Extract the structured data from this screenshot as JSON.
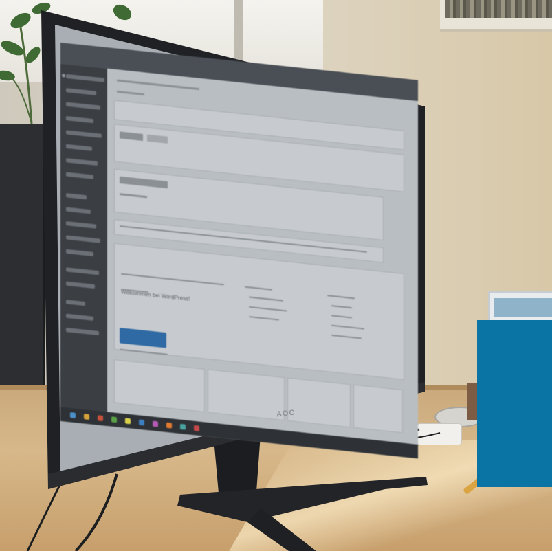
{
  "photo": {
    "subject": "",
    "monitor_brand": "AOC"
  },
  "screen_ui": {
    "welcome_heading": "Willkommen bei WordPress!",
    "primary_button": "",
    "colors": {
      "admin_bar": "#4a4f55",
      "sidebar": "#3b3f44",
      "button": "#2f6aa4",
      "brand_block": "#0a75a5"
    }
  }
}
